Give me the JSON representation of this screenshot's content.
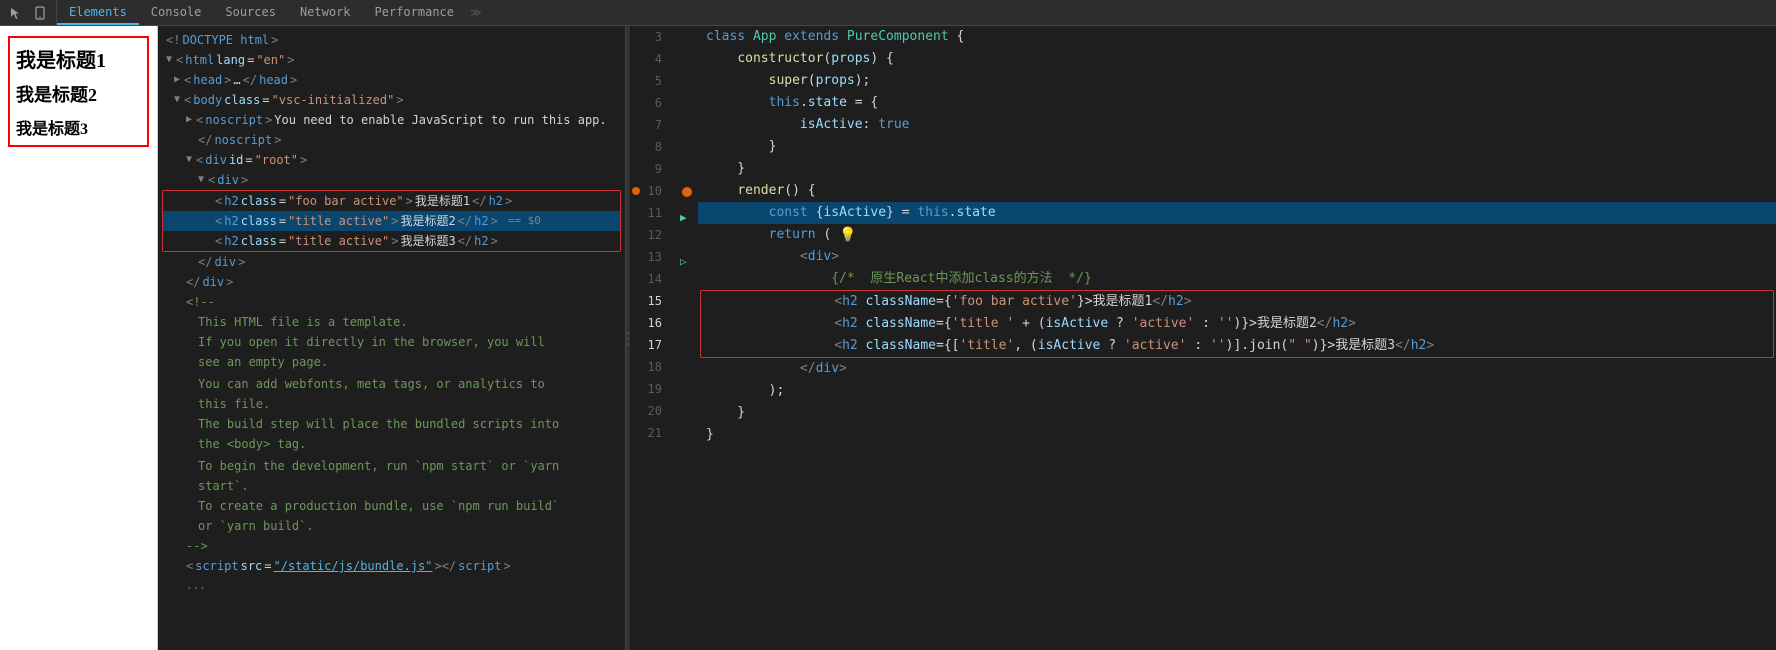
{
  "tabs": {
    "icons": [
      "cursor-icon",
      "mobile-icon"
    ],
    "items": [
      {
        "label": "Elements",
        "active": true
      },
      {
        "label": "Console",
        "active": false
      },
      {
        "label": "Sources",
        "active": false
      },
      {
        "label": "Network",
        "active": false
      },
      {
        "label": "Performance",
        "active": false
      }
    ]
  },
  "preview": {
    "titles": [
      "我是标题1",
      "我是标题2",
      "我是标题3"
    ]
  },
  "dom": {
    "lines": [
      {
        "text": "<!DOCTYPE html>",
        "indent": 0
      },
      {
        "html": true,
        "indent": 0,
        "open": true
      },
      {
        "head": true,
        "indent": 1
      },
      {
        "body": true,
        "indent": 0
      },
      {
        "noscript": true,
        "indent": 2
      },
      {
        "noscript_close": true,
        "indent": 2
      },
      {
        "div_root": true,
        "indent": 2
      },
      {
        "div_inner": true,
        "indent": 3
      },
      {
        "h2_1": true,
        "indent": 4,
        "selected": false
      },
      {
        "h2_2": true,
        "indent": 4,
        "selected": true
      },
      {
        "h2_3": true,
        "indent": 4,
        "selected": false
      },
      {
        "div_close": true,
        "indent": 3
      },
      {
        "div_close2": true,
        "indent": 2
      }
    ]
  },
  "code": {
    "lines": [
      {
        "num": 3,
        "content": "class App extends PureComponent {"
      },
      {
        "num": 4,
        "content": "    constructor(props) {"
      },
      {
        "num": 5,
        "content": "        super(props);"
      },
      {
        "num": 6,
        "content": "        this.state = {"
      },
      {
        "num": 7,
        "content": "            isActive: true"
      },
      {
        "num": 8,
        "content": "        }"
      },
      {
        "num": 9,
        "content": "    }"
      },
      {
        "num": 10,
        "content": "    render() {"
      },
      {
        "num": 11,
        "content": "        const {isActive} = this.state"
      },
      {
        "num": 12,
        "content": "        return ("
      },
      {
        "num": 13,
        "content": "            <div>"
      },
      {
        "num": 14,
        "content": "                {/*  原生React中添加class的方法  */}"
      },
      {
        "num": 15,
        "content": "                <h2 className={'foo bar active'}>我是标题1</h2>",
        "highlight": "red-top"
      },
      {
        "num": 16,
        "content": "                <h2 className={'title ' + (isActive ? 'active' : '')}>我是标题2</h2>",
        "highlight": "red-mid"
      },
      {
        "num": 17,
        "content": "                <h2 className={['title', (isActive ? 'active' : '')].join(' ')}>我是标题3</h2>",
        "highlight": "red-bottom"
      },
      {
        "num": 18,
        "content": "            </div>"
      },
      {
        "num": 19,
        "content": "        );"
      },
      {
        "num": 20,
        "content": "    }"
      },
      {
        "num": 21,
        "content": "}"
      }
    ]
  }
}
